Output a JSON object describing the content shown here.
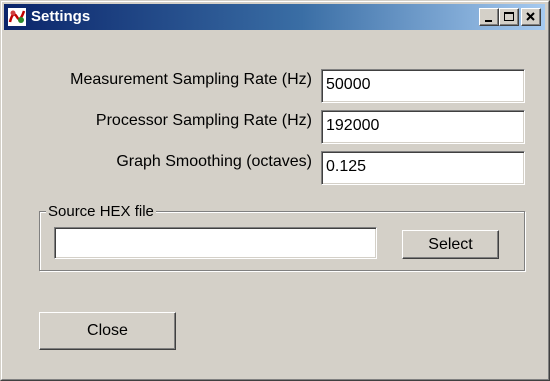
{
  "window": {
    "title": "Settings",
    "icon": "app-logo-icon"
  },
  "caption_buttons": {
    "minimize": "minimize-icon",
    "maximize": "maximize-icon",
    "close": "close-icon"
  },
  "fields": [
    {
      "label": "Measurement Sampling Rate (Hz)",
      "value": "50000"
    },
    {
      "label": "Processor Sampling Rate (Hz)",
      "value": "192000"
    },
    {
      "label": "Graph Smoothing (octaves)",
      "value": "0.125"
    }
  ],
  "source_hex": {
    "legend": "Source HEX file",
    "value": "",
    "select_label": "Select"
  },
  "close_label": "Close",
  "colors": {
    "face": "#d4d0c8",
    "title_start": "#0a246a",
    "title_end": "#a6caf0"
  }
}
